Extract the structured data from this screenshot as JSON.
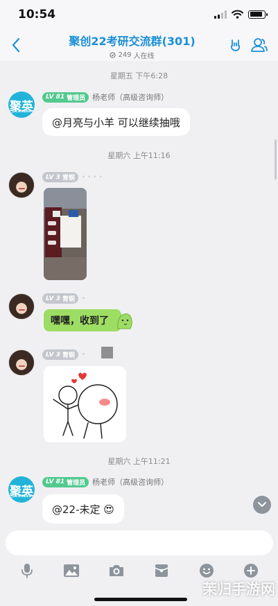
{
  "status_bar": {
    "time": "10:54"
  },
  "header": {
    "title": "聚创22考研交流群(301)",
    "online_count": "249",
    "online_suffix": "人在线"
  },
  "messages": [
    {
      "timestamp": "星期五 下午6:28"
    },
    {
      "avatar_text": "聚英",
      "avatar_sub": "JUCHUANG",
      "badge_level": "LV 81",
      "badge_role": "管理员",
      "sender": "杨老师（高级咨询师）",
      "text": "@月亮与小羊 可以继续抽哦"
    },
    {
      "timestamp": "星期六 上午11:16"
    },
    {
      "badge_level": "LV 3",
      "badge_role": "青铜",
      "type": "photo"
    },
    {
      "badge_level": "LV 3",
      "badge_role": "青铜",
      "text": "嘿嘿，收到了"
    },
    {
      "badge_level": "LV 3",
      "badge_role": "青铜",
      "type": "sticker"
    },
    {
      "timestamp": "星期六 上午11:21"
    },
    {
      "avatar_text": "聚英",
      "avatar_sub": "JUCHUANG",
      "badge_level": "LV 81",
      "badge_role": "管理员",
      "sender": "杨老师（高级咨询师）",
      "text": "@22-未定 😍"
    }
  ],
  "input": {
    "placeholder": ""
  },
  "watermark": "茉归手游网",
  "colors": {
    "accent": "#1a8fd8",
    "admin_badge": "#52c98f",
    "level_badge": "#c3c6cc",
    "green_bubble": "#9edd63"
  },
  "icons": [
    "back-icon",
    "rock-hand-icon",
    "group-members-icon",
    "microphone-icon",
    "image-icon",
    "camera-icon",
    "red-packet-icon",
    "emoji-icon",
    "plus-icon"
  ]
}
